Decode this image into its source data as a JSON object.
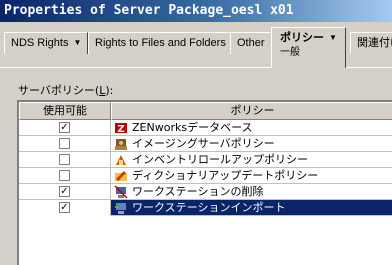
{
  "window": {
    "title": "Properties of Server Package_oesl x01"
  },
  "tabs": [
    {
      "label": "NDS Rights",
      "has_dropdown": true
    },
    {
      "label": "Rights to Files and Folders",
      "has_dropdown": false
    },
    {
      "label": "Other",
      "has_dropdown": false
    },
    {
      "label": "ポリシー",
      "sublabel": "一般",
      "has_dropdown": true,
      "active": true
    },
    {
      "label": "関連付け",
      "has_dropdown": false
    }
  ],
  "panel": {
    "label_prefix": "サーバポリシー(",
    "label_mnemonic": "L",
    "label_suffix": "):"
  },
  "table": {
    "columns": [
      "使用可能",
      "ポリシー"
    ],
    "rows": [
      {
        "enabled": true,
        "icon": "database-icon",
        "label": "ZENworksデータベース"
      },
      {
        "enabled": false,
        "icon": "imaging-icon",
        "label": "イメージングサーバポリシー"
      },
      {
        "enabled": false,
        "icon": "inventory-icon",
        "label": "インベントリロールアップポリシー"
      },
      {
        "enabled": false,
        "icon": "directory-update-icon",
        "label": "ディクショナリアップデートポリシー"
      },
      {
        "enabled": true,
        "icon": "workstation-delete-icon",
        "label": "ワークステーションの削除"
      },
      {
        "enabled": true,
        "icon": "workstation-import-icon",
        "label": "ワークステーションインポート",
        "selected": true
      }
    ]
  },
  "colors": {
    "selection": "#0a246a",
    "face": "#d4d0c8"
  }
}
